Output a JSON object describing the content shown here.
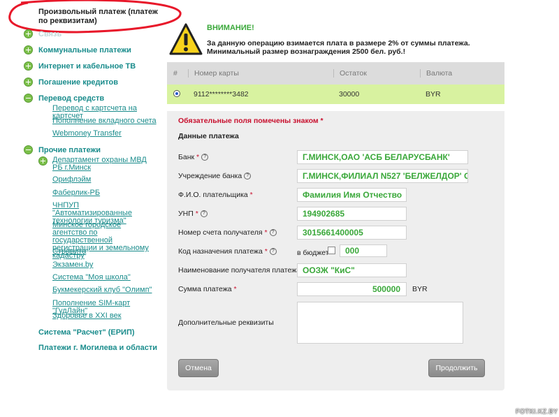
{
  "sidebar": {
    "title": "Произвольный платеж (платеж по реквизитам)",
    "hidden_item": "Связь",
    "items": {
      "utilities": "Коммунальные платежи",
      "internet": "Интернет и кабельное ТВ",
      "loans": "Погашение кредитов",
      "transfer": "Перевод средств",
      "other": "Прочие платежи"
    },
    "transfer_subs": [
      "Перевод с картсчета на картсчет",
      "Пополнение вкладного счета",
      "Webmoney Transfer"
    ],
    "dept": "Департамент охраны МВД РБ г.Минск",
    "other_subs": [
      "Орифлэйм",
      "Фаберлик-РБ",
      "ЧНПУП \"Автоматизированные технологии туризма\"",
      "Минское городское агентство по государственной регистрации и земельному кадастру",
      "Стравита",
      "Экзамен.by",
      "Система \"Моя школа\"",
      "Букмекерский клуб \"Олимп\"",
      "Пополнение SIM-карт \"ГудЛайн\"",
      "Здоровье в XXI век"
    ],
    "erip": "Система \"Расчет\" (ЕРИП)",
    "mogilev": "Платежи г. Могилева и области"
  },
  "warning": {
    "title": "ВНИМАНИЕ!",
    "text": "За данную операцию взимается плата в размере 2% от суммы платежа. Минимальный размер вознаграждения 2500 бел. руб.!"
  },
  "cards": {
    "headers": [
      "#",
      "Номер карты",
      "Остаток",
      "Валюта"
    ],
    "row": {
      "number": "9112********3482",
      "balance": "30000",
      "currency": "BYR"
    }
  },
  "form": {
    "required_note": "Обязательные поля помечены знаком *",
    "section": "Данные платежа",
    "labels": {
      "bank": "Банк",
      "branch": "Учреждение банка",
      "payer": "Ф.И.О. плательщика",
      "unp": "УНП",
      "account": "Номер счета получателя",
      "purpose": "Код назначения платежа",
      "recipient": "Наименование получателя платежа",
      "amount": "Сумма платежа",
      "extra": "Дополнительные реквизиты"
    },
    "values": {
      "bank": "Г.МИНСК,ОАО 'АСБ БЕЛАРУСБАНК'",
      "branch": "Г.МИНСК,ФИЛИАЛ N527 'БЕЛЖЕЛДОР' С",
      "payer": "Фамилия Имя Отчество",
      "unp": "194902685",
      "account": "3015661400005",
      "purpose": "000",
      "recipient": "ООЗЖ \"КиС\"",
      "amount": "500000"
    },
    "budget_label": "в бюджет",
    "currency": "BYR",
    "star": "*",
    "help": "?",
    "cancel": "Отмена",
    "continue": "Продолжить"
  },
  "watermark": "FOTKI.KZ.BY",
  "colors": {
    "accent": "#3aa83a",
    "link": "#1a8c8c",
    "required": "#c8102e",
    "selected_row": "#d8f2a0"
  }
}
